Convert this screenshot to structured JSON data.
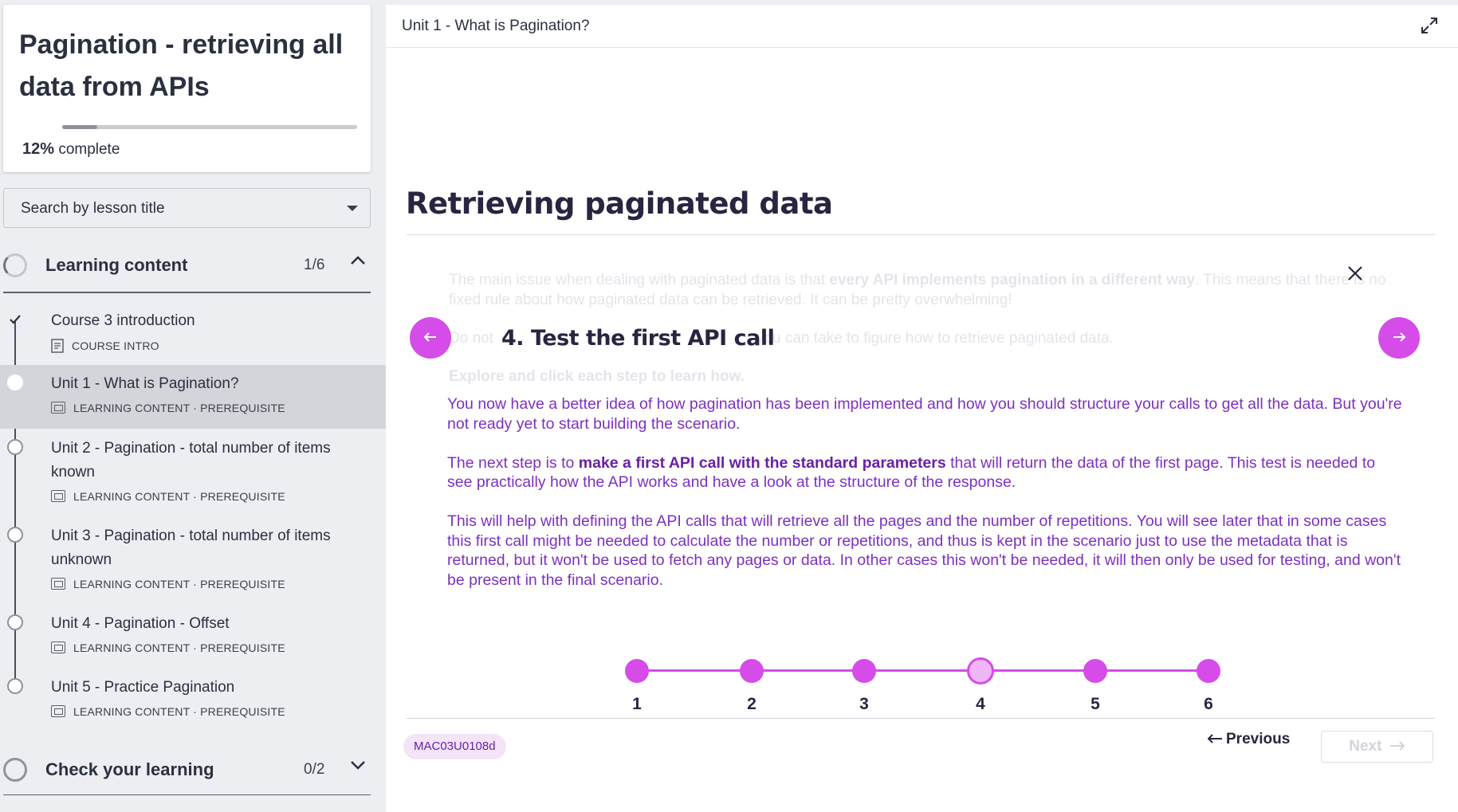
{
  "course": {
    "title": "Pagination - retrieving all data from APIs",
    "progress_percent": "12%",
    "progress_label": "complete",
    "progress_value": 0.12
  },
  "search": {
    "placeholder": "Search by lesson title"
  },
  "sections": [
    {
      "label": "Learning content",
      "count": "1/6",
      "expanded": true
    },
    {
      "label": "Check your learning",
      "count": "0/2",
      "expanded": false
    }
  ],
  "lessons": [
    {
      "title": "Course 3 introduction",
      "meta": "COURSE INTRO",
      "status": "done",
      "icon": "document-icon"
    },
    {
      "title": "Unit 1 - What is Pagination?",
      "meta": "LEARNING CONTENT · PREREQUISITE",
      "status": "current",
      "icon": "slides-icon"
    },
    {
      "title": "Unit 2 - Pagination - total number of items known",
      "meta": "LEARNING CONTENT · PREREQUISITE",
      "status": "todo",
      "icon": "slides-icon"
    },
    {
      "title": "Unit 3 - Pagination - total number of items unknown",
      "meta": "LEARNING CONTENT · PREREQUISITE",
      "status": "todo",
      "icon": "slides-icon"
    },
    {
      "title": "Unit 4 - Pagination - Offset",
      "meta": "LEARNING CONTENT · PREREQUISITE",
      "status": "todo",
      "icon": "slides-icon"
    },
    {
      "title": "Unit 5 - Practice Pagination",
      "meta": "LEARNING CONTENT · PREREQUISITE",
      "status": "todo",
      "icon": "slides-icon"
    }
  ],
  "main": {
    "breadcrumb": "Unit 1 - What is Pagination?",
    "title": "Retrieving paginated data",
    "ghost": {
      "p1_a": "The main issue when dealing with paginated data is that ",
      "p1_b": "every API implements pagination in a different way",
      "p1_c": ". This means that there is no fixed rule about how paginated data can be retrieved. It can be pretty overwhelming!",
      "p2_a": "Do not",
      "p2_b": "you can take to figure how to retrieve paginated data.",
      "p3": "Explore and click each step to learn how."
    },
    "step": {
      "heading": "4. Test the first API call",
      "p1": "You now have a better idea of how pagination has been implemented and how you should structure your calls to get all the data. But you're not ready yet to start building the scenario.",
      "p2_a": "The next step is to ",
      "p2_b": "make a first API call with the standard parameters",
      "p2_c": " that will return the data of the first page. This test is needed to see practically how the API works and have a look at the structure of the response.",
      "p3": "This will help with defining the API calls that will retrieve all the pages and the number of repetitions. You will see later that in some cases this first call might be needed to calculate the number or repetitions, and thus is kept in the scenario just to use the metadata that is returned, but it won't be used to fetch any pages or data. In other cases this won't be needed, it will then only be used for testing, and won't be present in the final scenario."
    },
    "stepper": {
      "labels": [
        "1",
        "2",
        "3",
        "4",
        "5",
        "6"
      ],
      "current": 4
    },
    "code": "MAC03U0108d",
    "previous_label": "Previous",
    "next_label": "Next",
    "accent_color": "#d54ce8",
    "text_color": "#7d30bf"
  }
}
